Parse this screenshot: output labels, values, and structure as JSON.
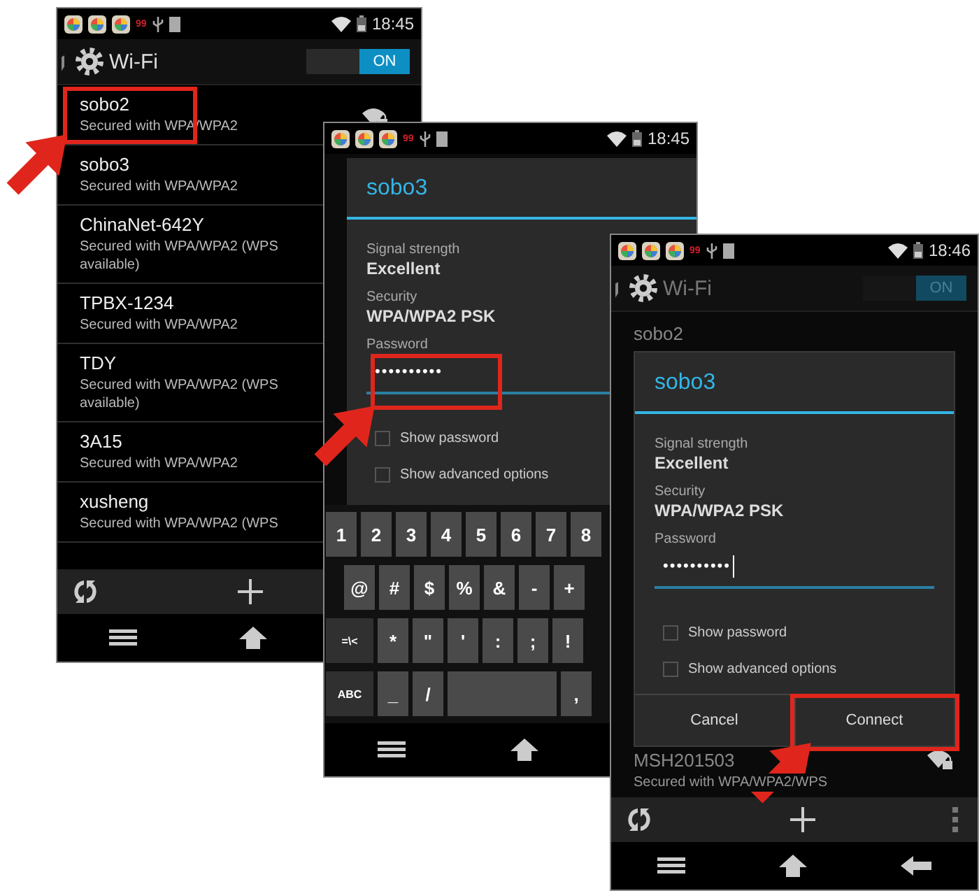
{
  "screens": [
    {
      "kind": "list",
      "status_bar": {
        "badge": "99",
        "time": "18:45"
      },
      "title": "Wi-Fi",
      "toggle": {
        "label": "ON",
        "on": true
      },
      "networks": [
        {
          "name": "sobo2",
          "security": "Secured with WPA/WPA2"
        },
        {
          "name": "sobo3",
          "security": "Secured with WPA/WPA2"
        },
        {
          "name": "ChinaNet-642Y",
          "security": "Secured with WPA/WPA2 (WPS available)"
        },
        {
          "name": "TPBX-1234",
          "security": "Secured with WPA/WPA2"
        },
        {
          "name": "TDY",
          "security": "Secured with WPA/WPA2 (WPS available)"
        },
        {
          "name": "3A15",
          "security": "Secured with WPA/WPA2"
        },
        {
          "name": "xusheng",
          "security": "Secured with WPA/WPA2 (WPS"
        }
      ]
    },
    {
      "kind": "password",
      "status_bar": {
        "badge": "99",
        "time": "18:45"
      },
      "dialog": {
        "title": "sobo3",
        "fields": [
          {
            "label": "Signal strength",
            "value": "Excellent"
          },
          {
            "label": "Security",
            "value": "WPA/WPA2 PSK"
          }
        ],
        "password_label": "Password",
        "password": "••••••••••",
        "cursor": false,
        "options": [
          {
            "label": "Show password",
            "checked": false
          },
          {
            "label": "Show advanced options",
            "checked": false
          }
        ]
      },
      "keyboard": [
        [
          {
            "kind": "char",
            "label": "1"
          },
          {
            "kind": "char",
            "label": "2"
          },
          {
            "kind": "char",
            "label": "3"
          },
          {
            "kind": "char",
            "label": "4"
          },
          {
            "kind": "char",
            "label": "5"
          },
          {
            "kind": "char",
            "label": "6"
          },
          {
            "kind": "char",
            "label": "7"
          },
          {
            "kind": "char",
            "label": "8"
          }
        ],
        [
          {
            "kind": "char",
            "label": "@"
          },
          {
            "kind": "char",
            "label": "#"
          },
          {
            "kind": "char",
            "label": "$"
          },
          {
            "kind": "char",
            "label": "%"
          },
          {
            "kind": "char",
            "label": "&"
          },
          {
            "kind": "char",
            "label": "-"
          },
          {
            "kind": "char",
            "label": "+"
          }
        ],
        [
          {
            "kind": "function",
            "label": "=\\<"
          },
          {
            "kind": "char",
            "label": "*"
          },
          {
            "kind": "char",
            "label": "\""
          },
          {
            "kind": "char",
            "label": "'"
          },
          {
            "kind": "char",
            "label": ":"
          },
          {
            "kind": "char",
            "label": ";"
          },
          {
            "kind": "char",
            "label": "!"
          }
        ],
        [
          {
            "kind": "function",
            "label": "ABC"
          },
          {
            "kind": "char",
            "label": "_"
          },
          {
            "kind": "char",
            "label": "/"
          },
          {
            "kind": "space"
          },
          {
            "kind": "char",
            "label": ","
          }
        ]
      ]
    },
    {
      "kind": "connect",
      "status_bar": {
        "badge": "99",
        "time": "18:46"
      },
      "title": "Wi-Fi",
      "toggle": {
        "label": "ON",
        "on": true
      },
      "networks": [
        {
          "name": "sobo2"
        },
        {
          "name": "MSH201503",
          "security": "Secured with WPA/WPA2/WPS"
        }
      ],
      "dialog": {
        "title": "sobo3",
        "fields": [
          {
            "label": "Signal strength",
            "value": "Excellent"
          },
          {
            "label": "Security",
            "value": "WPA/WPA2 PSK"
          }
        ],
        "password_label": "Password",
        "password": "••••••••••",
        "cursor": true,
        "options": [
          {
            "label": "Show password",
            "checked": false
          },
          {
            "label": "Show advanced options",
            "checked": false
          }
        ],
        "buttons": [
          "Cancel",
          "Connect"
        ]
      }
    }
  ]
}
